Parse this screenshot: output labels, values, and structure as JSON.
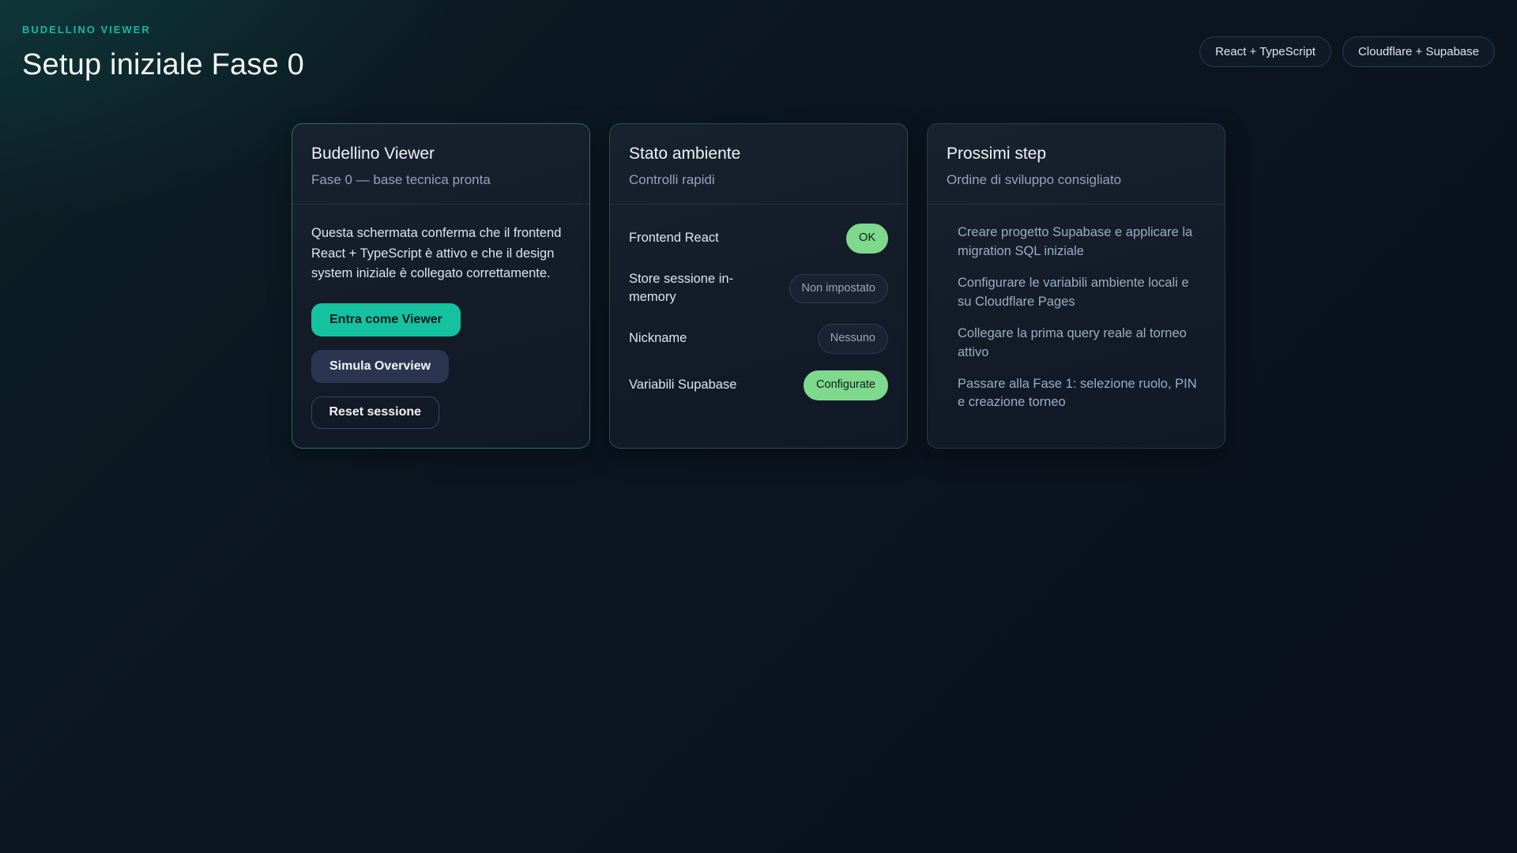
{
  "page": {
    "brand": "BUDELLINO VIEWER",
    "title": "Setup iniziale Fase 0",
    "badges": [
      {
        "label": "React + TypeScript"
      },
      {
        "label": "Cloudflare + Supabase"
      }
    ]
  },
  "cards": {
    "viewer": {
      "title": "Budellino Viewer",
      "subtitle": "Fase 0 — base tecnica pronta",
      "body": "Questa schermata conferma che il frontend React + TypeScript è attivo e che il design system iniziale è collegato correttamente.",
      "buttons": {
        "primary": "Entra come Viewer",
        "secondary": "Simula Overview",
        "ghost": "Reset sessione"
      }
    },
    "status": {
      "title": "Stato ambiente",
      "subtitle": "Controlli rapidi",
      "rows": [
        {
          "label": "Frontend React",
          "value": "OK",
          "state": "success"
        },
        {
          "label": "Store sessione in-memory",
          "value": "Non impostato",
          "state": "neutral"
        },
        {
          "label": "Nickname",
          "value": "Nessuno",
          "state": "neutral"
        },
        {
          "label": "Variabili Supabase",
          "value": "Configurate",
          "state": "success"
        }
      ]
    },
    "steps": {
      "title": "Prossimi step",
      "subtitle": "Ordine di sviluppo consigliato",
      "items": [
        "Creare progetto Supabase e applicare la migration SQL iniziale",
        "Configurare le variabili ambiente locali e su Cloudflare Pages",
        "Collegare la prima query reale al torneo attivo",
        "Passare alla Fase 1: selezione ruolo, PIN e creazione torneo"
      ]
    }
  },
  "colors": {
    "accent_teal": "#14c2a0",
    "brand_teal": "#14b8a6",
    "success_pill": "#7ed98d",
    "secondary_button": "#2b3550",
    "background_dark": "#0a101c",
    "card_background": "#141c29"
  }
}
